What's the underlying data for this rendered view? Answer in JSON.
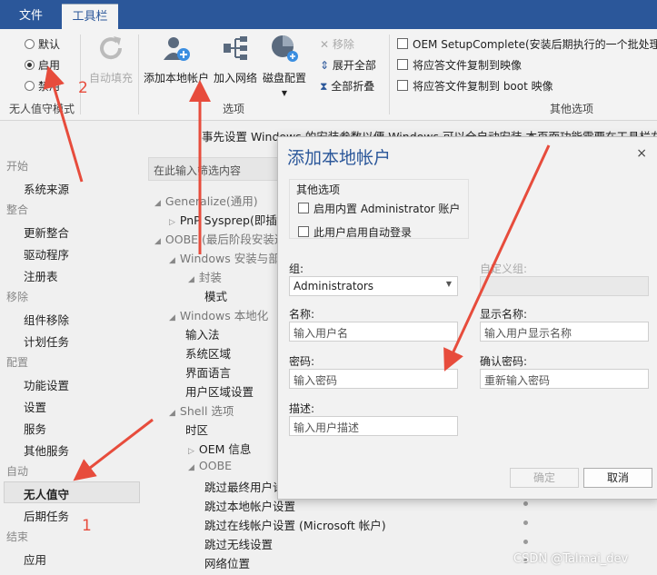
{
  "tabs": [
    {
      "label": "文件"
    },
    {
      "label": "工具栏"
    }
  ],
  "ribbon": {
    "unattended": {
      "options": [
        "默认",
        "启用",
        "禁用"
      ],
      "selected_index": 1,
      "group_label": "无人值守模式"
    },
    "autofill_label": "自动填充",
    "add_local_account_label": "添加本地帐户",
    "join_network_label": "加入网络",
    "disk_config_label": "磁盘配置",
    "remove_label": "移除",
    "expand_all_label": "展开全部",
    "collapse_all_label": "全部折叠",
    "options_group_label": "选项",
    "other_options": [
      "OEM SetupComplete(安装后期执行的一个批处理",
      "将应答文件复制到映像",
      "将应答文件复制到 boot 映像"
    ],
    "other_options_group_label": "其他选项"
  },
  "banner": "事先设置 Windows 的安装参数以便 Windows 可以全自动安装 本页面功能需要在工具栏左上角",
  "nav": {
    "sections": [
      {
        "header": "开始",
        "items": [
          "系统来源"
        ]
      },
      {
        "header": "整合",
        "items": [
          "更新整合",
          "驱动程序",
          "注册表"
        ]
      },
      {
        "header": "移除",
        "items": [
          "组件移除",
          "计划任务"
        ]
      },
      {
        "header": "配置",
        "items": [
          "功能设置",
          "设置",
          "服务",
          "其他服务"
        ]
      },
      {
        "header": "自动",
        "items": [
          "无人值守",
          "后期任务"
        ]
      },
      {
        "header": "结束",
        "items": [
          "应用"
        ]
      }
    ]
  },
  "filter_placeholder": "在此输入筛选内容",
  "tree": [
    "Generalize(通用)",
    "PnP Sysprep(即插",
    "OOBE (最后阶段安装过",
    "Windows 安装与部",
    "封装",
    "模式",
    "Windows 本地化",
    "输入法",
    "系统区域",
    "界面语言",
    "用户区域设置",
    "Shell 选项",
    "时区",
    "OEM 信息",
    "OOBE",
    "跳过最终用户许",
    "跳过本地帐户设置",
    "跳过在线帐户设置 (Microsoft 帐户)",
    "跳过无线设置",
    "网络位置"
  ],
  "dialog": {
    "title": "添加本地帐户",
    "close_glyph": "×",
    "other_options_label": "其他选项",
    "enable_admin_label": "启用内置 Administrator 账户",
    "auto_logon_label": "此用户启用自动登录",
    "group_label": "组:",
    "group_value": "Administrators",
    "custom_group_label": "自定义组:",
    "name_label": "名称:",
    "name_placeholder": "输入用户名",
    "display_name_label": "显示名称:",
    "display_name_placeholder": "输入用户显示名称",
    "password_label": "密码:",
    "password_placeholder": "输入密码",
    "confirm_password_label": "确认密码:",
    "confirm_password_placeholder": "重新输入密码",
    "description_label": "描述:",
    "description_placeholder": "输入用户描述",
    "ok_label": "确定",
    "cancel_label": "取消"
  },
  "annotations": {
    "num1": "1",
    "num2": "2"
  },
  "watermark": "CSDN @Talmai_dev",
  "colors": {
    "accent": "#2b579a",
    "arrow": "#e74c3c"
  }
}
